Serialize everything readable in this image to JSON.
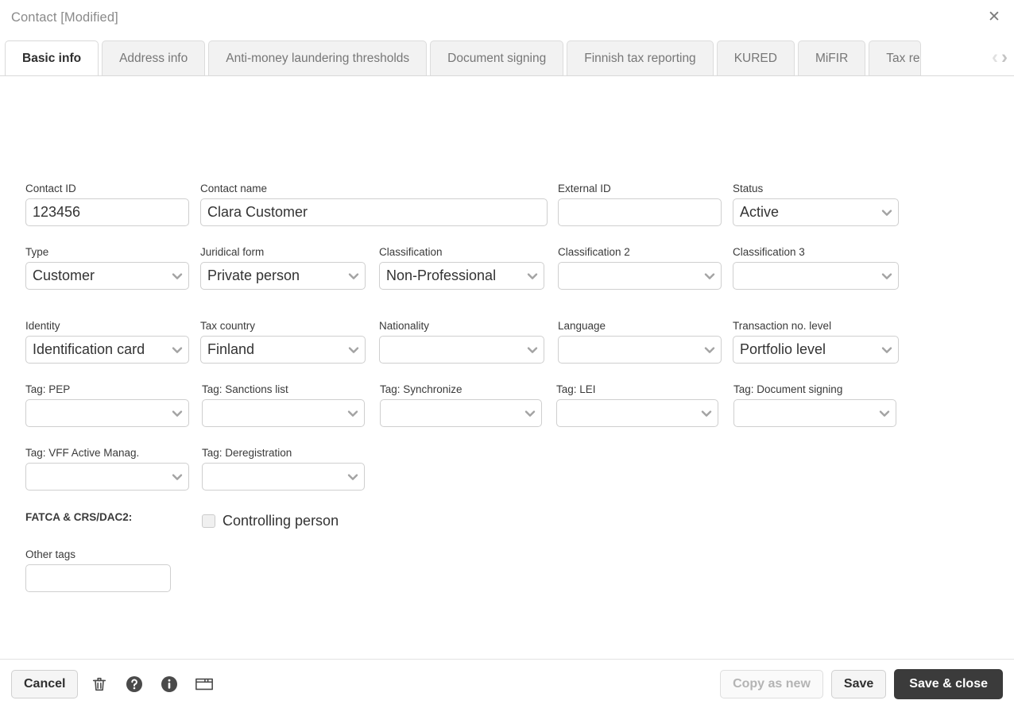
{
  "window": {
    "title": "Contact [Modified]",
    "close_icon": "close-icon"
  },
  "tabs": {
    "items": [
      {
        "label": "Basic info",
        "active": true
      },
      {
        "label": "Address info",
        "active": false
      },
      {
        "label": "Anti-money laundering thresholds",
        "active": false
      },
      {
        "label": "Document signing",
        "active": false
      },
      {
        "label": "Finnish tax reporting",
        "active": false
      },
      {
        "label": "KURED",
        "active": false
      },
      {
        "label": "MiFIR",
        "active": false
      },
      {
        "label": "Tax re",
        "active": false
      }
    ],
    "scroll_prev": "‹",
    "scroll_next": "›"
  },
  "form": {
    "row1": [
      {
        "label": "Contact ID",
        "value": "123456",
        "type": "text"
      },
      {
        "label": "Contact name",
        "value": "Clara Customer",
        "type": "text"
      },
      {
        "label": "External ID",
        "value": "",
        "type": "text"
      },
      {
        "label": "Status",
        "value": "Active",
        "type": "select"
      }
    ],
    "row2": [
      {
        "label": "Type",
        "value": "Customer",
        "type": "select"
      },
      {
        "label": "Juridical form",
        "value": "Private person",
        "type": "select"
      },
      {
        "label": "Classification",
        "value": "Non-Professional",
        "type": "select"
      },
      {
        "label": "Classification 2",
        "value": "",
        "type": "select"
      },
      {
        "label": "Classification 3",
        "value": "",
        "type": "select"
      }
    ],
    "row3": [
      {
        "label": "Identity",
        "value": "Identification card",
        "type": "select"
      },
      {
        "label": "Tax country",
        "value": "Finland",
        "type": "select"
      },
      {
        "label": "Nationality",
        "value": "",
        "type": "select"
      },
      {
        "label": "Language",
        "value": "",
        "type": "select"
      },
      {
        "label": "Transaction no. level",
        "value": "Portfolio level",
        "type": "select"
      }
    ],
    "row4": [
      {
        "label": "Tag: PEP",
        "value": "",
        "type": "select"
      },
      {
        "label": "Tag: Sanctions list",
        "value": "",
        "type": "select"
      },
      {
        "label": "Tag: Synchronize",
        "value": "",
        "type": "select"
      },
      {
        "label": "Tag: LEI",
        "value": "",
        "type": "select"
      },
      {
        "label": "Tag: Document signing",
        "value": "",
        "type": "select"
      }
    ],
    "row5": [
      {
        "label": "Tag: VFF Active Manag.",
        "value": "",
        "type": "select"
      },
      {
        "label": "Tag: Deregistration",
        "value": "",
        "type": "select"
      }
    ],
    "fatca_label": "FATCA & CRS/DAC2:",
    "controlling_person": {
      "label": "Controlling person",
      "checked": false
    },
    "other_tags": {
      "label": "Other tags",
      "value": ""
    }
  },
  "footer": {
    "cancel": "Cancel",
    "copy_as_new": "Copy as new",
    "save": "Save",
    "save_close": "Save & close",
    "icons": [
      "trash-icon",
      "help-icon",
      "info-icon",
      "window-icon"
    ]
  },
  "colors": {
    "primary_button": "#3b3b3b",
    "border": "#cfcfcf",
    "tab_inactive": "#f2f2f2",
    "text": "#333333",
    "muted": "#8a8a8a"
  }
}
